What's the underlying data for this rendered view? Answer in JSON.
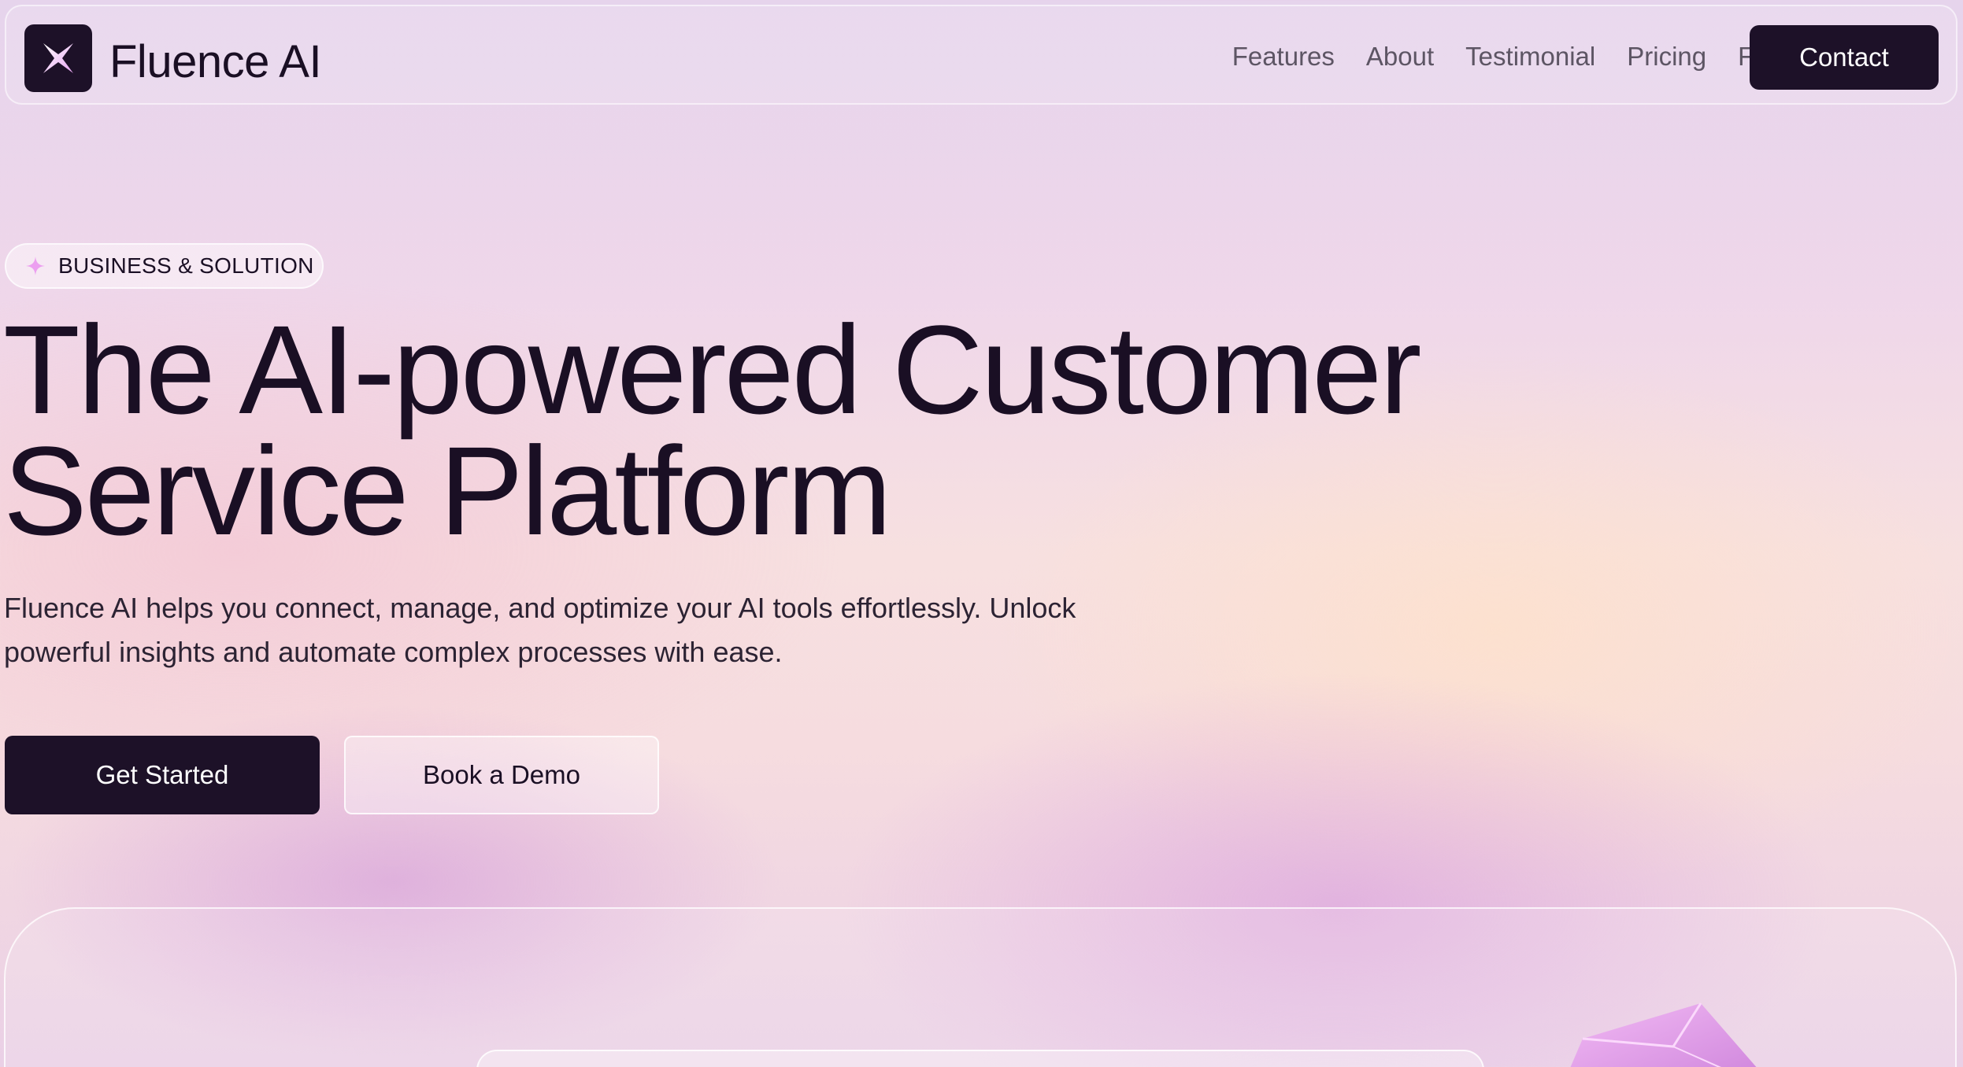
{
  "brand": {
    "name": "Fluence AI",
    "logo_icon": "x-star-icon"
  },
  "nav": {
    "links": [
      "Features",
      "About",
      "Testimonial",
      "Pricing",
      "Faq"
    ],
    "contact_label": "Contact"
  },
  "hero": {
    "badge": "BUSINESS & SOLUTION",
    "headline_line1": "The AI-powered Customer",
    "headline_line2": "Service Platform",
    "subtitle_line1": "Fluence AI helps you connect, manage, and optimize your AI tools effortlessly. Unlock",
    "subtitle_line2": "powerful insights and automate complex processes with ease.",
    "primary_cta": "Get Started",
    "secondary_cta": "Book a Demo"
  },
  "colors": {
    "dark": "#1d1128",
    "accent_pink": "#e9a6ef",
    "nav_text": "#5d5564"
  }
}
